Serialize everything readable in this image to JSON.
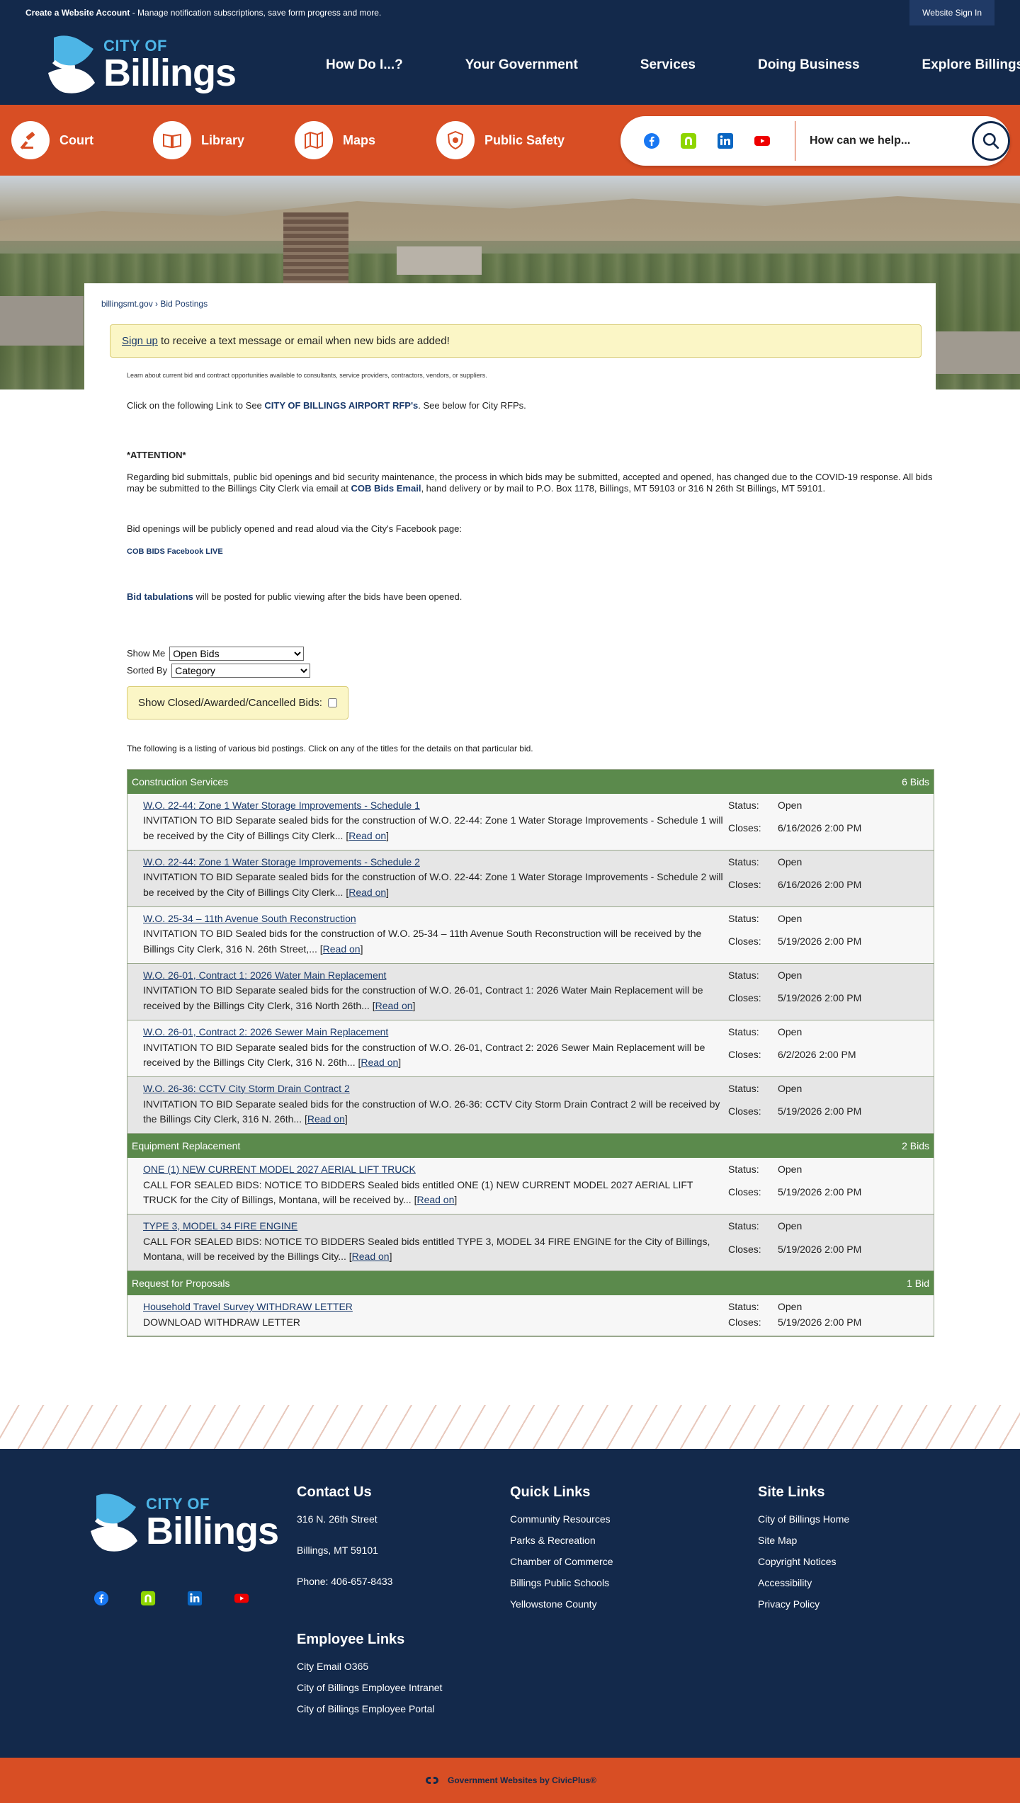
{
  "topbar": {
    "account_link": "Create a Website Account",
    "account_text": " - Manage notification subscriptions, save form progress and more.",
    "signin": "Website Sign In"
  },
  "logo": {
    "city_of": "CITY OF",
    "billings": "Billings"
  },
  "nav": [
    "How Do I...?",
    "Your Government",
    "Services",
    "Doing Business",
    "Explore Billings"
  ],
  "quicklinks": [
    {
      "label": "Court",
      "icon": "gavel-icon"
    },
    {
      "label": "Library",
      "icon": "book-icon"
    },
    {
      "label": "Maps",
      "icon": "map-icon"
    },
    {
      "label": "Public Safety",
      "icon": "badge-icon"
    }
  ],
  "social": [
    "facebook-icon",
    "nextdoor-icon",
    "linkedin-icon",
    "youtube-icon"
  ],
  "search": {
    "placeholder": "How can we help..."
  },
  "breadcrumb": {
    "home": "billingsmt.gov",
    "sep": " › ",
    "current": "Bid Postings"
  },
  "signup": {
    "link": "Sign up",
    "text": " to receive a text message or email when new bids are added!"
  },
  "intro_small": "Learn about current bid and contract opportunities available to consultants, service providers, contractors, vendors, or suppliers.",
  "airport": {
    "prefix": "Click on the following Link to See ",
    "link": "CITY OF BILLINGS AIRPORT RFP's",
    "suffix": ". See below for City RFPs."
  },
  "attention": {
    "heading": "*ATTENTION*",
    "body_a": "Regarding bid submittals, public bid openings and bid security maintenance, the process in which bids may be submitted, accepted and opened, has changed due to the COVID-19 response. All bids may be submitted to the Billings City Clerk via email at ",
    "email_link": "COB Bids Email",
    "body_b": ", hand delivery or by mail to P.O. Box 1178, Billings, MT 59103 or 316 N 26th St Billings, MT 59101."
  },
  "facebook": {
    "text": "Bid openings will be publicly opened and read aloud via the City's Facebook page:",
    "link": "COB BIDS Facebook LIVE"
  },
  "tabulations": {
    "link": "Bid tabulations",
    "text": " will be posted for public viewing after the bids have been opened."
  },
  "filters": {
    "show_me_label": "Show Me",
    "show_me_value": "Open Bids",
    "sorted_by_label": "Sorted By",
    "sorted_by_value": "Category",
    "closed_label": "Show Closed/Awarded/Cancelled Bids:"
  },
  "listing_note": "The following is a listing of various bid postings. Click on any of the titles for the details on that particular bid.",
  "labels": {
    "status": "Status:",
    "closes": "Closes:",
    "read_on": "Read on"
  },
  "categories": [
    {
      "name": "Construction Services",
      "count": "6 Bids",
      "bids": [
        {
          "title": "W.O. 22-44: Zone 1 Water Storage Improvements - Schedule 1",
          "desc": "INVITATION TO BID Separate sealed bids for the construction of W.O. 22-44: Zone 1 Water Storage Improvements - Schedule 1 will be received by the City of Billings City Clerk...",
          "status": "Open",
          "closes": "6/16/2026 2:00 PM"
        },
        {
          "title": "W.O. 22-44: Zone 1 Water Storage Improvements - Schedule 2",
          "desc": "INVITATION TO BID Separate sealed bids for the construction of W.O. 22-44: Zone 1 Water Storage Improvements - Schedule 2 will be received by the City of Billings City Clerk...",
          "status": "Open",
          "closes": "6/16/2026 2:00 PM"
        },
        {
          "title": "W.O. 25-34 – 11th Avenue South Reconstruction",
          "desc": "INVITATION TO BID Sealed bids for the construction of W.O. 25-34 – 11th Avenue South Reconstruction will be received by the Billings City Clerk, 316 N. 26th Street,...",
          "status": "Open",
          "closes": "5/19/2026 2:00 PM"
        },
        {
          "title": "W.O. 26-01, Contract 1: 2026 Water Main Replacement",
          "desc": "INVITATION TO BID Separate sealed bids for the construction of W.O. 26-01, Contract 1: 2026 Water Main Replacement will be received by the Billings City Clerk, 316 North 26th...",
          "status": "Open",
          "closes": "5/19/2026 2:00 PM"
        },
        {
          "title": "W.O. 26-01, Contract 2: 2026 Sewer Main Replacement",
          "desc": "INVITATION TO BID Separate sealed bids for the construction of W.O. 26-01, Contract 2: 2026 Sewer Main Replacement will be received by the Billings City Clerk, 316 N. 26th...",
          "status": "Open",
          "closes": "6/2/2026 2:00 PM"
        },
        {
          "title": "W.O. 26-36: CCTV City Storm Drain Contract 2",
          "desc": "INVITATION TO BID Separate sealed bids for the construction of W.O. 26-36: CCTV City Storm Drain Contract 2 will be received by the Billings City Clerk, 316 N. 26th...",
          "status": "Open",
          "closes": "5/19/2026 2:00 PM"
        }
      ]
    },
    {
      "name": "Equipment Replacement",
      "count": "2 Bids",
      "bids": [
        {
          "title": "ONE (1) NEW CURRENT MODEL 2027 AERIAL LIFT TRUCK",
          "desc": "CALL FOR SEALED BIDS: NOTICE TO BIDDERS Sealed bids entitled ONE (1) NEW CURRENT MODEL 2027 AERIAL LIFT TRUCK for the City of Billings, Montana, will be received by...",
          "status": "Open",
          "closes": "5/19/2026 2:00 PM"
        },
        {
          "title": "TYPE 3, MODEL 34 FIRE ENGINE",
          "desc": "CALL FOR SEALED BIDS: NOTICE TO BIDDERS Sealed bids entitled TYPE 3, MODEL 34 FIRE ENGINE for the City of Billings, Montana, will be received by the Billings City...",
          "status": "Open",
          "closes": "5/19/2026 2:00 PM"
        }
      ]
    },
    {
      "name": "Request for Proposals",
      "count": "1 Bid",
      "bids": [
        {
          "title": "Household Travel Survey WITHDRAW LETTER",
          "desc": "DOWNLOAD WITHDRAW LETTER",
          "status": "Open",
          "closes": "5/19/2026 2:00 PM",
          "no_readon": true
        }
      ]
    }
  ],
  "footer": {
    "contact": {
      "heading": "Contact Us",
      "address1": "316 N. 26th Street",
      "address2": "Billings, MT 59101",
      "phone": "Phone: 406-657-8433"
    },
    "quick": {
      "heading": "Quick Links",
      "items": [
        "Community Resources",
        "Parks & Recreation",
        "Chamber of Commerce",
        "Billings Public Schools",
        "Yellowstone County"
      ]
    },
    "site": {
      "heading": "Site Links",
      "items": [
        "City of Billings Home",
        "Site Map",
        "Copyright Notices",
        "Accessibility",
        "Privacy Policy"
      ]
    },
    "employee": {
      "heading": "Employee Links",
      "items": [
        "City Email O365",
        "City of Billings Employee Intranet",
        "City of Billings Employee Portal"
      ]
    }
  },
  "civicplus": "Government Websites by CivicPlus®",
  "colors": {
    "navy": "#13294b",
    "orange": "#d84e24",
    "green": "#5b8a4c",
    "sky": "#4db5e6"
  }
}
